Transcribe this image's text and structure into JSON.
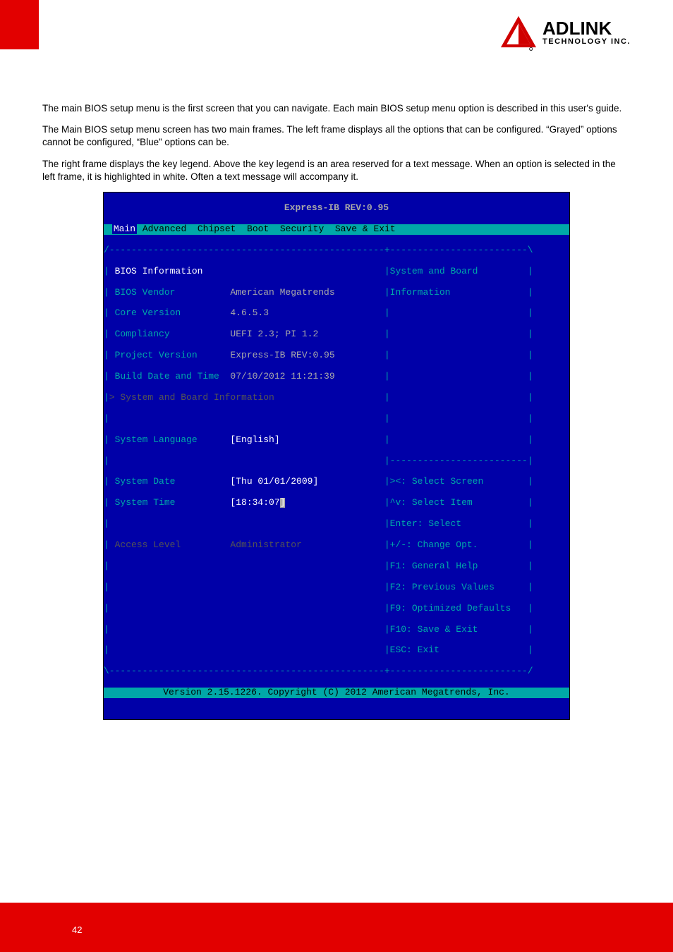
{
  "logo": {
    "main": "ADLINK",
    "sub": "TECHNOLOGY INC."
  },
  "para": {
    "p1": "The main BIOS setup menu is the first screen that you can navigate. Each main BIOS setup menu option is described in this user's guide.",
    "p2": "The Main BIOS setup menu screen has two main frames. The left frame displays all the options that can be configured. “Grayed” options cannot be configured, “Blue” options can be.",
    "p3": "The right frame displays the key legend. Above the key legend is an area reserved for a text message. When an option is selected in the left frame, it is highlighted in white. Often a text message will accompany it."
  },
  "bios": {
    "title": "Express-IB REV:0.95",
    "menu": {
      "highlight": "Main",
      "rest": " Advanced  Chipset  Boot  Security  Save & Exit"
    },
    "sectionHeader": "BIOS Information",
    "rows": {
      "vendor": {
        "label": "BIOS Vendor",
        "value": "American Megatrends"
      },
      "core": {
        "label": "Core Version",
        "value": "4.6.5.3"
      },
      "compliancy": {
        "label": "Compliancy",
        "value": "UEFI 2.3; PI 1.2"
      },
      "project": {
        "label": "Project Version",
        "value": "Express-IB REV:0.95"
      },
      "build": {
        "label": "Build Date and Time",
        "value": "07/10/2012 11:21:39"
      }
    },
    "submenu": "System and Board Information",
    "lang": {
      "label": "System Language",
      "value": "[English]"
    },
    "date": {
      "label": "System Date",
      "value": "[Thu 01/01/2009]"
    },
    "time": {
      "label": "System Time",
      "value": "[18:34:07",
      "cursor": "]"
    },
    "access": {
      "label": "Access Level",
      "value": "Administrator"
    },
    "help": {
      "line1": "System and Board",
      "line2": "Information",
      "k1": "><: Select Screen",
      "k2": "^v: Select Item",
      "k3": "Enter: Select",
      "k4": "+/-: Change Opt.",
      "k5": "F1: General Help",
      "k6": "F2: Previous Values",
      "k7": "F9: Optimized Defaults",
      "k8": "F10: Save & Exit",
      "k9": "ESC: Exit"
    },
    "footer": "Version 2.15.1226. Copyright (C) 2012 American Megatrends, Inc."
  },
  "pageNumber": "42"
}
